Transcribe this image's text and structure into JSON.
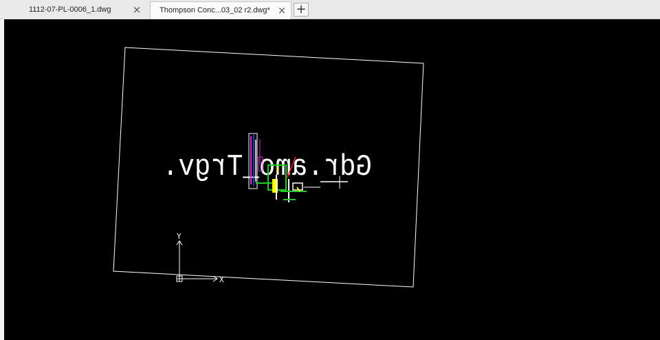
{
  "tabs": [
    {
      "label": "1112-07-PL-0006_1.dwg",
      "active": false
    },
    {
      "label": "Thompson Conc...03_02 r2.dwg*",
      "active": true
    }
  ],
  "tab_close_glyph": "×",
  "new_tab_glyph": "+",
  "drawing": {
    "mirrored_text": "Gdr.amo_Trgv.",
    "ucs_y_label": "Y",
    "ucs_x_label": "X"
  },
  "colors": {
    "canvas_background": "#000000",
    "linework": "#ffffff",
    "accent_green": "#22cc22",
    "accent_yellow": "#ffff00",
    "accent_red": "#ff2020",
    "accent_magenta": "#cc33cc",
    "accent_blue": "#3344ff"
  }
}
